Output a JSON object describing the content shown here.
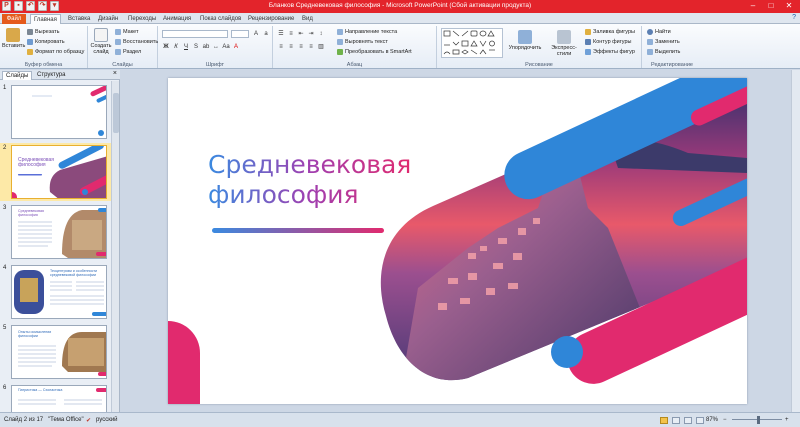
{
  "titlebar": {
    "title": "Бланков Средневековая философия - Microsoft PowerPoint (Сбой активации продукта)",
    "min": "–",
    "max": "□",
    "close": "✕"
  },
  "tabs": [
    "Файл",
    "Главная",
    "Вставка",
    "Дизайн",
    "Переходы",
    "Анимация",
    "Показ слайдов",
    "Рецензирование",
    "Вид"
  ],
  "ribbon": {
    "clipboard": {
      "paste": "Вставить",
      "cut": "Вырезать",
      "copy": "Копировать",
      "format": "Формат по образцу",
      "label": "Буфер обмена"
    },
    "slides": {
      "new": "Создать слайд",
      "layout": "Макет",
      "reset": "Восстановить",
      "section": "Раздел",
      "label": "Слайды"
    },
    "font": {
      "label": "Шрифт"
    },
    "paragraph": {
      "direction": "Направление текста",
      "align": "Выровнять текст",
      "smartart": "Преобразовать в SmartArt",
      "label": "Абзац"
    },
    "drawing": {
      "arrange": "Упорядочить",
      "styles": "Экспресс-стили",
      "fill": "Заливка фигуры",
      "outline": "Контур фигуры",
      "effects": "Эффекты фигур",
      "label": "Рисование"
    },
    "editing": {
      "find": "Найти",
      "replace": "Заменить",
      "select": "Выделить",
      "label": "Редактирование"
    }
  },
  "panel": {
    "tab_slides": "Слайды",
    "tab_outline": "Структура",
    "close": "×"
  },
  "thumbnails": [
    {
      "num": "1"
    },
    {
      "num": "2",
      "title": "Средневековая философия"
    },
    {
      "num": "3",
      "title": "Средневековая философия"
    },
    {
      "num": "4",
      "title": "Теоцентризм и особенности средневековой философии"
    },
    {
      "num": "5",
      "title": "Опыты осмыслении философии"
    },
    {
      "num": "6",
      "title": "Патристика — Схоластика"
    }
  ],
  "slide": {
    "title_line1": "Средневековая",
    "title_line2": "философия"
  },
  "status": {
    "slide_info": "Слайд 2 из 17",
    "theme": "\"Тема Office\"",
    "language": "русский",
    "zoom": "87%"
  },
  "colors": {
    "blue": "#2f86d8",
    "pink": "#e12a6e",
    "title_accent": "#e3242b"
  }
}
